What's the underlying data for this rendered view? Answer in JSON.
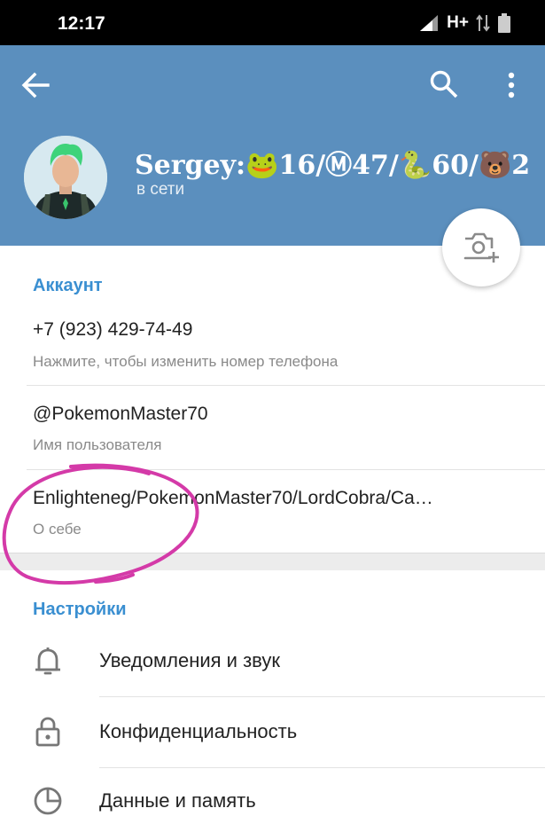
{
  "status_bar": {
    "time": "12:17",
    "network": "H+"
  },
  "header": {
    "name": "Sergey:🐸16/Ⓜ47/🐍60/🐻2",
    "status": "в сети",
    "bg_color": "#5b8fbe",
    "icons": [
      "back-arrow-icon",
      "search-icon",
      "more-vertical-icon",
      "add-photo-icon"
    ]
  },
  "account": {
    "section_title": "Аккаунт",
    "phone": "+7 (923) 429-74-49",
    "phone_hint": "Нажмите, чтобы изменить номер телефона",
    "username": "@PokemonMaster70",
    "username_hint": "Имя пользователя",
    "bio": "Enlighteneg/PokemonMaster70/LordCobra/Ca…",
    "bio_hint": "О себе"
  },
  "settings": {
    "section_title": "Настройки",
    "items": [
      {
        "label": "Уведомления и звук",
        "icon": "bell-icon"
      },
      {
        "label": "Конфиденциальность",
        "icon": "lock-icon"
      },
      {
        "label": "Данные и память",
        "icon": "pie-chart-icon"
      }
    ]
  },
  "accent_color": "#3a8fd1",
  "annotation_color": "#d43aa8"
}
